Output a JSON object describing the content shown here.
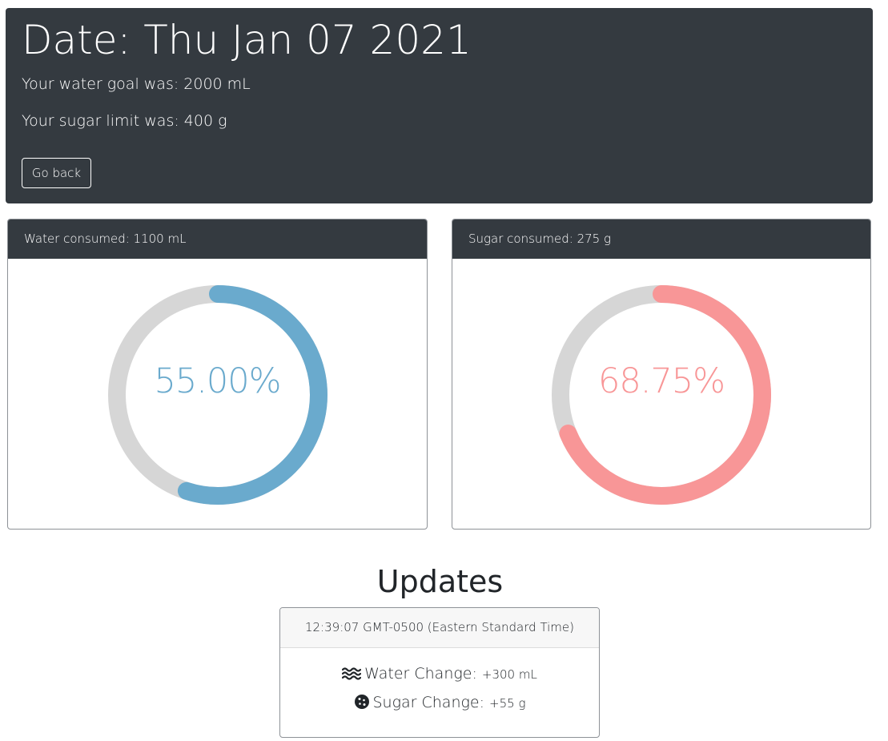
{
  "header": {
    "title": "Date: Thu Jan 07 2021",
    "water_goal_text": "Your water goal was: 2000 mL",
    "sugar_limit_text": "Your sugar limit was: 400 g",
    "go_back_label": "Go back"
  },
  "water_card": {
    "header": "Water consumed: 1100 mL",
    "percent_label": "55.00%",
    "fraction": 0.55,
    "color": "#6aaacd",
    "track_color": "#d6d6d6"
  },
  "sugar_card": {
    "header": "Sugar consumed: 275 g",
    "percent_label": "68.75%",
    "fraction": 0.6875,
    "color": "#f89697",
    "track_color": "#d6d6d6"
  },
  "updates": {
    "title": "Updates",
    "entry": {
      "time": "12:39:07 GMT-0500 (Eastern Standard Time)",
      "water_label": "Water Change:",
      "water_value": "+300 mL",
      "water_icon": "water-waves-icon",
      "sugar_label": "Sugar Change:",
      "sugar_value": "+55 g",
      "sugar_icon": "cookie-icon"
    }
  }
}
